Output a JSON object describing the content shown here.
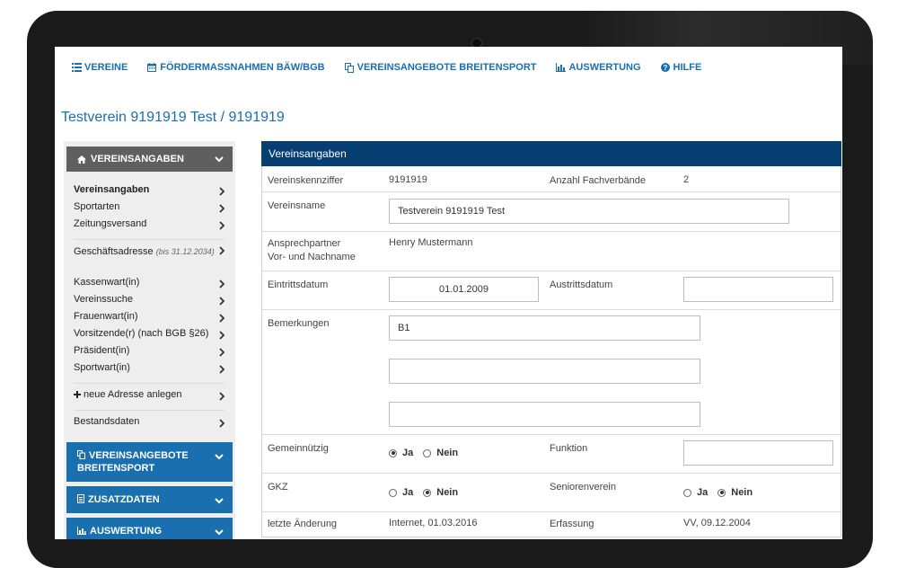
{
  "nav": {
    "items": [
      {
        "label": "VEREINE",
        "icon": "list-icon"
      },
      {
        "label": "FÖRDERMASSNAHMEN BÄW/BGB",
        "icon": "calendar-icon"
      },
      {
        "label": "VEREINSANGEBOTE BREITENSPORT",
        "icon": "copy-icon"
      },
      {
        "label": "AUSWERTUNG",
        "icon": "bar-chart-icon"
      },
      {
        "label": "HILFE",
        "icon": "question-circle-icon"
      }
    ]
  },
  "page": {
    "title": "Testverein 9191919 Test / 9191919"
  },
  "sidebar": {
    "header": "VEREINSANGABEN",
    "items": [
      "Vereinsangaben",
      "Sportarten",
      "Zeitungsversand",
      "Geschäftsadresse",
      "(bis 31.12.2034)",
      "Kassenwart(in)",
      "Vereinssuche",
      "Frauenwart(in)",
      "Vorsitzende(r) (nach BGB §26)",
      "Präsident(in)",
      "Sportwart(in)",
      "neue Adresse anlegen",
      "Bestandsdaten"
    ],
    "sections": [
      "VEREINSANGEBOTE BREITENSPORT",
      "ZUSATZDATEN",
      "AUSWERTUNG"
    ]
  },
  "panel": {
    "title": "Vereinsangaben",
    "vereinskennziffer_label": "Vereinskennziffer",
    "vereinskennziffer": "9191919",
    "anzahl_label": "Anzahl Fachverbände",
    "anzahl": "2",
    "vereinsname_label": "Vereinsname",
    "vereinsname": "Testverein 9191919 Test",
    "ansprechpartner_label_1": "Ansprechpartner",
    "ansprechpartner_label_2": "Vor- und Nachname",
    "ansprechpartner": "Henry Mustermann",
    "eintritt_label": "Eintrittsdatum",
    "eintritt": "01.01.2009",
    "austritt_label": "Austrittsdatum",
    "austritt": "",
    "bemerkungen_label": "Bemerkungen",
    "bemerkungen": [
      "B1",
      "",
      ""
    ],
    "gemeinnuetzig_label": "Gemeinnützig",
    "funktion_label": "Funktion",
    "funktion": "",
    "gkz_label": "GKZ",
    "seniorenverein_label": "Seniorenverein",
    "ja": "Ja",
    "nein": "Nein",
    "letzte_label": "letzte Änderung",
    "letzte": "Internet, 01.03.2016",
    "erfassung_label": "Erfassung",
    "erfassung": "VV, 09.12.2004"
  }
}
